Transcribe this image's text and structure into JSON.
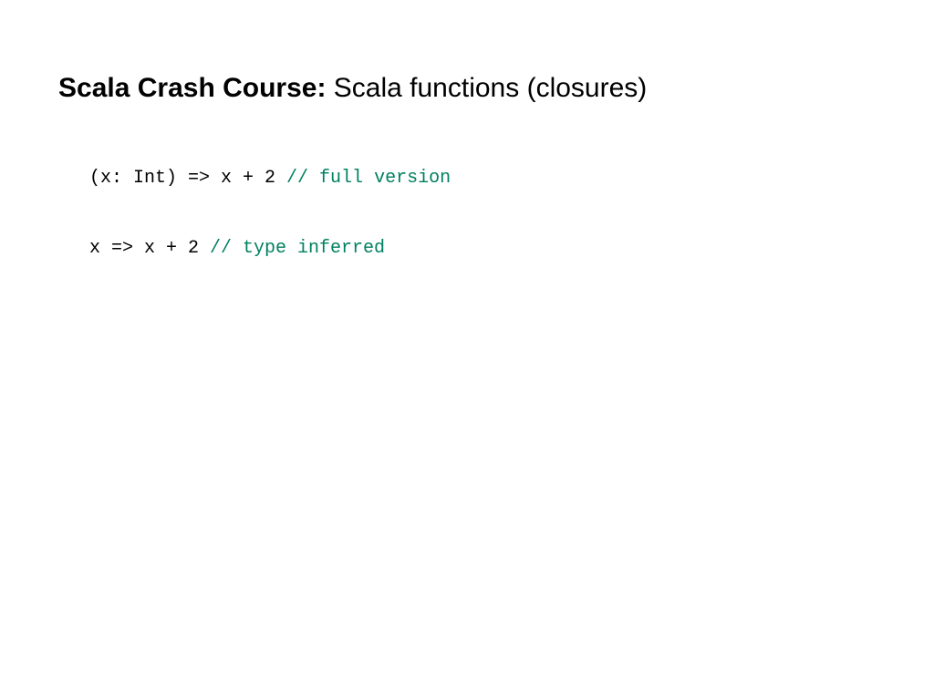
{
  "title": {
    "bold": "Scala Crash Course:",
    "regular": " Scala functions (closures)"
  },
  "code": {
    "line1": {
      "text": "(x: Int) => x + 2 ",
      "comment": "// full version"
    },
    "line2": {
      "text": "x => x + 2 ",
      "comment": "// type inferred"
    }
  }
}
